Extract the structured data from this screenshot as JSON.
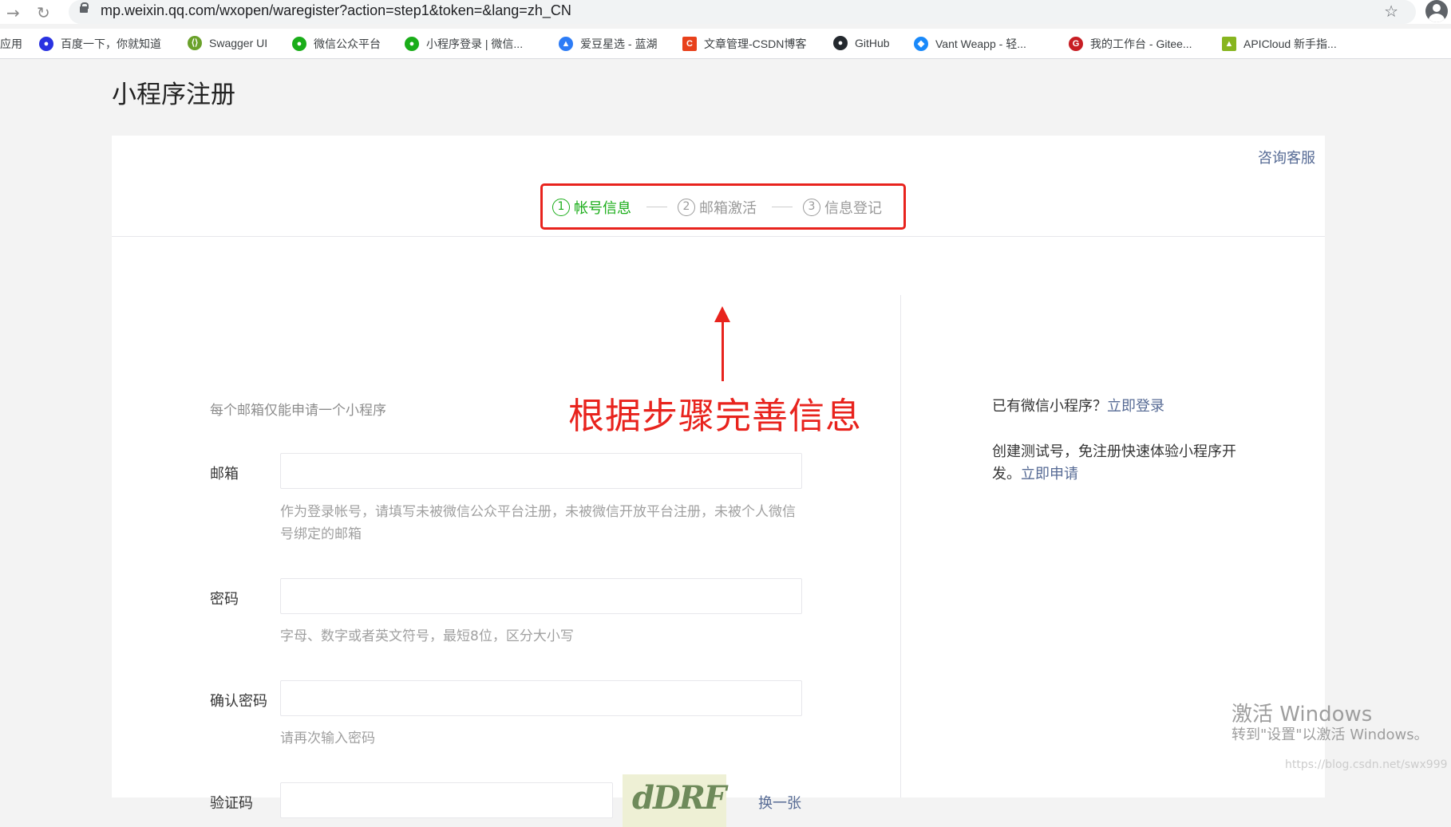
{
  "browser": {
    "url": "mp.weixin.qq.com/wxopen/waregister?action=step1&token=&lang=zh_CN"
  },
  "bookmarks": [
    {
      "label": "应用",
      "icon": "apps-icon"
    },
    {
      "label": "百度一下，你就知道",
      "icon": "baidu-icon",
      "color": "#2932e1"
    },
    {
      "label": "Swagger UI",
      "icon": "swagger-icon",
      "color": "#6aa12a"
    },
    {
      "label": "微信公众平台",
      "icon": "wechat-icon",
      "color": "#1aad19"
    },
    {
      "label": "小程序登录 | 微信...",
      "icon": "wechat-icon",
      "color": "#1aad19"
    },
    {
      "label": "爱豆星选 - 蓝湖",
      "icon": "lanhu-icon",
      "color": "#2d7cf6"
    },
    {
      "label": "文章管理-CSDN博客",
      "icon": "csdn-icon",
      "color": "#e8411b"
    },
    {
      "label": "GitHub",
      "icon": "github-icon",
      "color": "#24292e"
    },
    {
      "label": "Vant Weapp - 轻...",
      "icon": "vant-icon",
      "color": "#1989fa"
    },
    {
      "label": "我的工作台 - Gitee...",
      "icon": "gitee-icon",
      "color": "#c71d23"
    },
    {
      "label": "APICloud 新手指...",
      "icon": "apicloud-icon",
      "color": "#87b51f"
    }
  ],
  "page": {
    "title": "小程序注册",
    "consult": "咨询客服",
    "steps": [
      {
        "num": "1",
        "label": "帐号信息",
        "active": true
      },
      {
        "num": "2",
        "label": "邮箱激活",
        "active": false
      },
      {
        "num": "3",
        "label": "信息登记",
        "active": false
      }
    ],
    "annotation": "根据步骤完善信息",
    "tip": "每个邮箱仅能申请一个小程序",
    "form": {
      "email_label": "邮箱",
      "email_hint": "作为登录帐号，请填写未被微信公众平台注册，未被微信开放平台注册，未被个人微信号绑定的邮箱",
      "password_label": "密码",
      "password_hint": "字母、数字或者英文符号，最短8位，区分大小写",
      "confirm_label": "确认密码",
      "confirm_hint": "请再次输入密码",
      "captcha_label": "验证码",
      "captcha_text": "dDRF",
      "captcha_change": "换一张"
    },
    "side": {
      "have_prefix": "已有微信小程序？",
      "login_link": "立即登录",
      "test_prefix": "创建测试号，免注册快速体验小程序开发。",
      "apply_link": "立即申请"
    }
  },
  "watermark": {
    "line1": "激活 Windows",
    "line2": "转到\"设置\"以激活 Windows。",
    "csdn": "https://blog.csdn.net/swx999"
  }
}
